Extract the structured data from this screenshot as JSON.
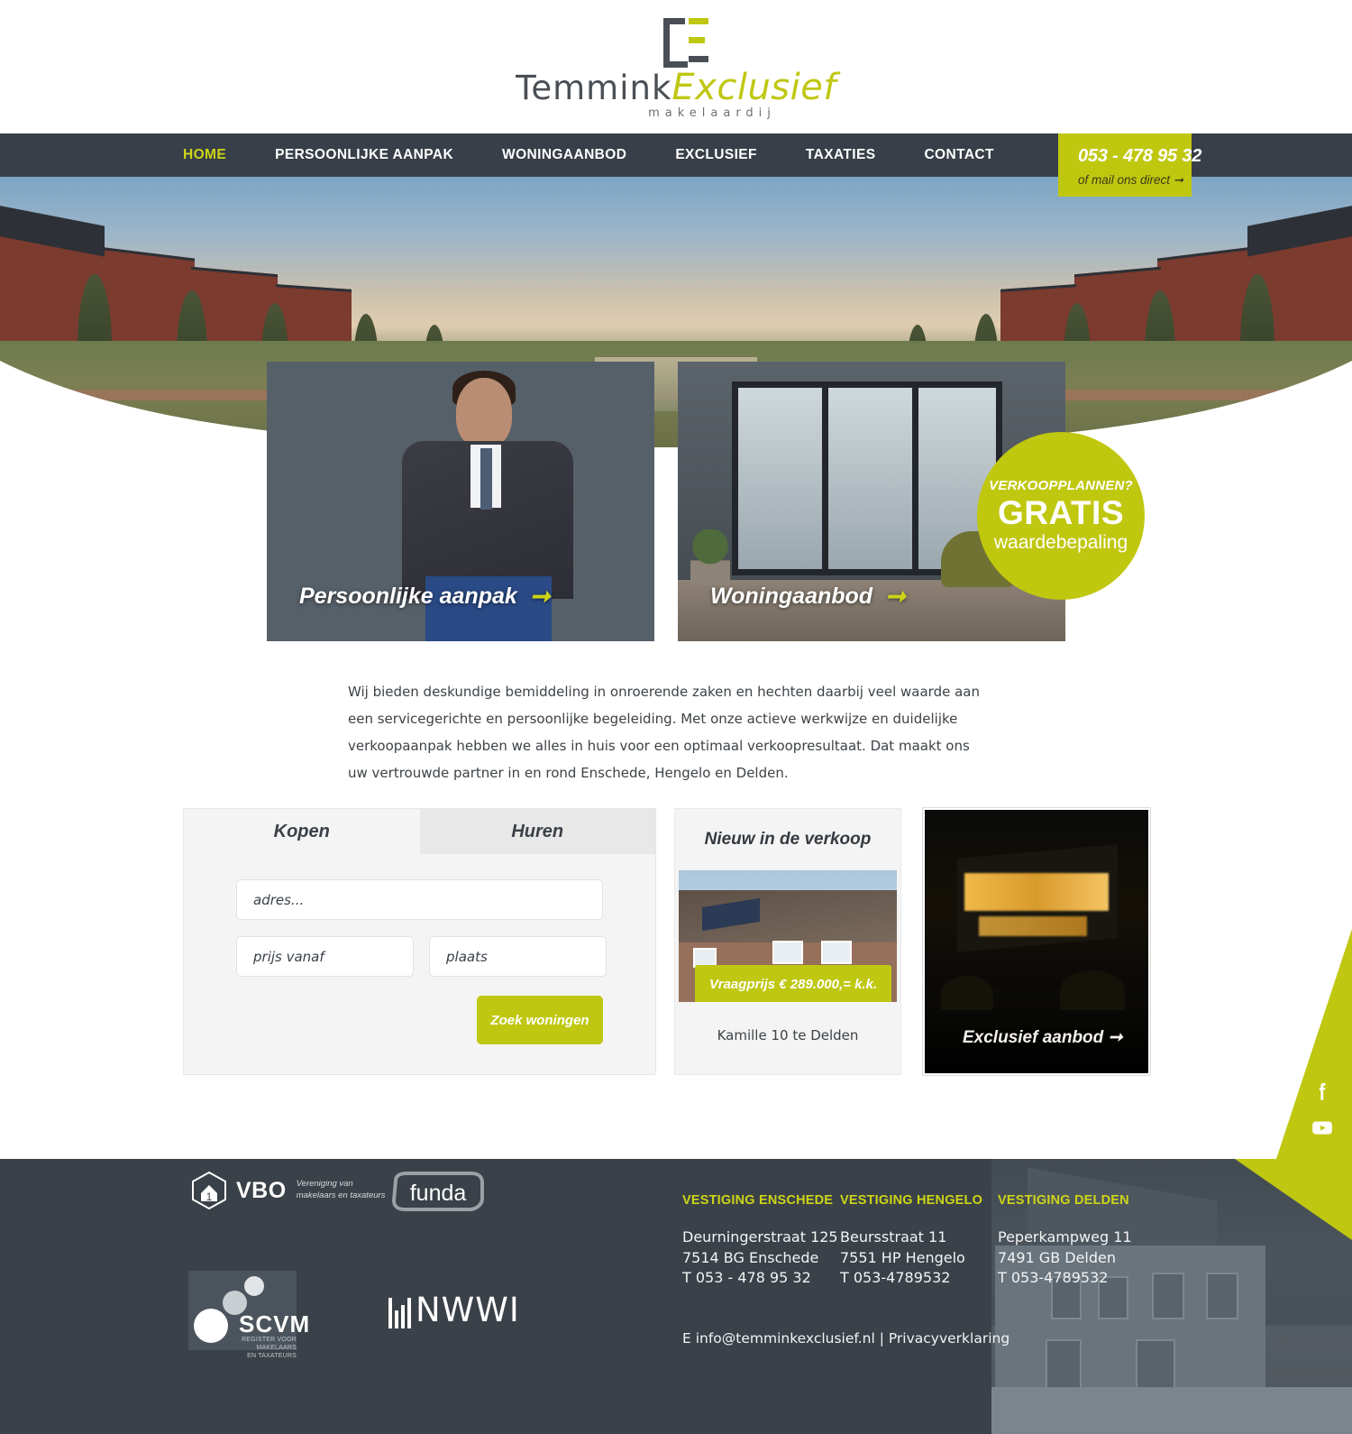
{
  "logo": {
    "name_part1": "Temmink",
    "name_part2": "Exclusief",
    "tagline": "makelaardij"
  },
  "nav": {
    "items": [
      {
        "label": "HOME",
        "active": true
      },
      {
        "label": "PERSOONLIJKE AANPAK",
        "active": false
      },
      {
        "label": "WONINGAANBOD",
        "active": false
      },
      {
        "label": "EXCLUSIEF",
        "active": false
      },
      {
        "label": "TAXATIES",
        "active": false
      },
      {
        "label": "CONTACT",
        "active": false
      }
    ],
    "phone": "053 - 478 95 32",
    "phone_sub": "of mail ons direct ➞"
  },
  "hero_cards": {
    "card_a_label": "Persoonlijke aanpak",
    "card_a_arrow": "➞",
    "card_b_label": "Woningaanbod",
    "card_b_arrow": "➞"
  },
  "badge": {
    "line1": "VERKOOPPLANNEN?",
    "line2": "GRATIS",
    "line3": "waardebepaling"
  },
  "intro": {
    "text": "Wij bieden deskundige bemiddeling in onroerende zaken en hechten daarbij veel waarde aan een servicegerichte en persoonlijke begeleiding. Met onze actieve werkwijze en duidelijke verkoopaanpak hebben we alles in huis voor een optimaal verkoopresultaat. Dat maakt ons uw vertrouwde partner in en rond Enschede, Hengelo en Delden."
  },
  "search": {
    "tab_buy": "Kopen",
    "tab_rent": "Huren",
    "address_placeholder": "adres...",
    "price_placeholder": "prijs vanaf",
    "city_placeholder": "plaats",
    "submit_label": "Zoek woningen"
  },
  "listing": {
    "title": "Nieuw in de verkoop",
    "price": "Vraagprijs € 289.000,= k.k.",
    "address": "Kamille 10 te Delden"
  },
  "exclusive": {
    "label": "Exclusief aanbod ➞"
  },
  "social": {
    "facebook": "facebook-icon",
    "youtube": "youtube-icon"
  },
  "footer": {
    "partners": {
      "vbo_name": "VBO",
      "vbo_sub_line1": "Vereniging van",
      "vbo_sub_line2": "makelaars en taxateurs",
      "funda_name": "funda",
      "scvm_name": "SCVM",
      "scvm_sub_line1": "REGISTER VOOR MAKELAARS",
      "scvm_sub_line2": "EN TAXATEURS",
      "nwwi_name": "NWWI"
    },
    "branches": [
      {
        "heading": "VESTIGING ENSCHEDE",
        "street": "Deurningerstraat 125",
        "postcode": "7514 BG Enschede",
        "phone": "T 053 - 478 95 32"
      },
      {
        "heading": "VESTIGING HENGELO",
        "street": "Beursstraat 11",
        "postcode": "7551 HP Hengelo",
        "phone": "T 053-4789532"
      },
      {
        "heading": "VESTIGING DELDEN",
        "street": "Peperkampweg 11",
        "postcode": "7491 GB Delden",
        "phone": "T 053-4789532"
      }
    ],
    "email_line": "E info@temminkexclusief.nl | Privacyverklaring"
  },
  "colors": {
    "accent": "#bfc711",
    "accent_bright": "#cdd418",
    "dark": "#383f48",
    "footer_dark": "#3a4148"
  }
}
